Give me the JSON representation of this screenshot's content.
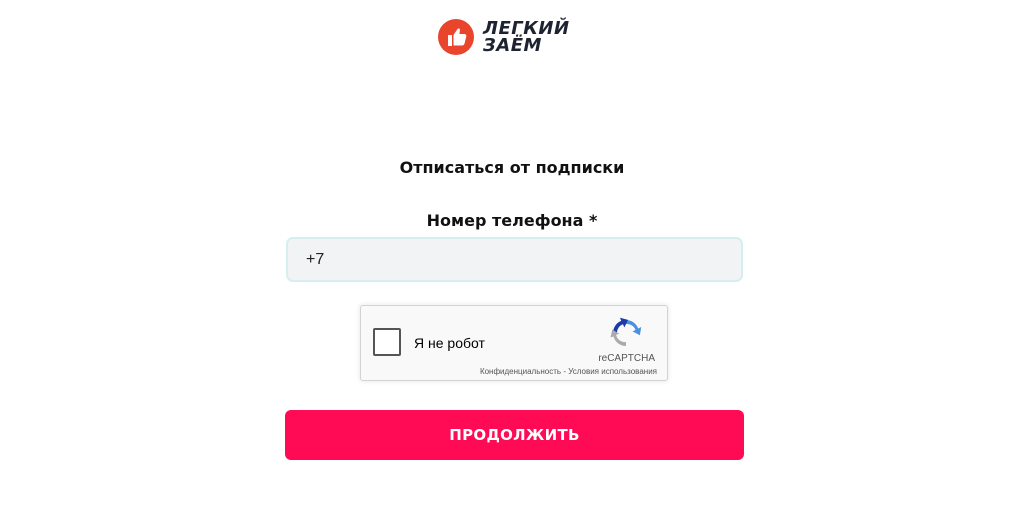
{
  "brand": {
    "logo_line1": "ЛЕГКИЙ",
    "logo_line2": "ЗАЁМ",
    "logo_color": "#e8452c",
    "text_color": "#1d2330"
  },
  "form": {
    "title": "Отписаться от подписки",
    "phone_label": "Номер телефона *",
    "phone_value": "+7",
    "submit_label": "ПРОДОЛЖИТЬ",
    "submit_color": "#ff0a54"
  },
  "recaptcha": {
    "checkbox_label": "Я не робот",
    "brand": "reCAPTCHA",
    "privacy_link": "Конфиденциальность",
    "separator": " - ",
    "terms_link": "Условия использования",
    "checked": false
  }
}
